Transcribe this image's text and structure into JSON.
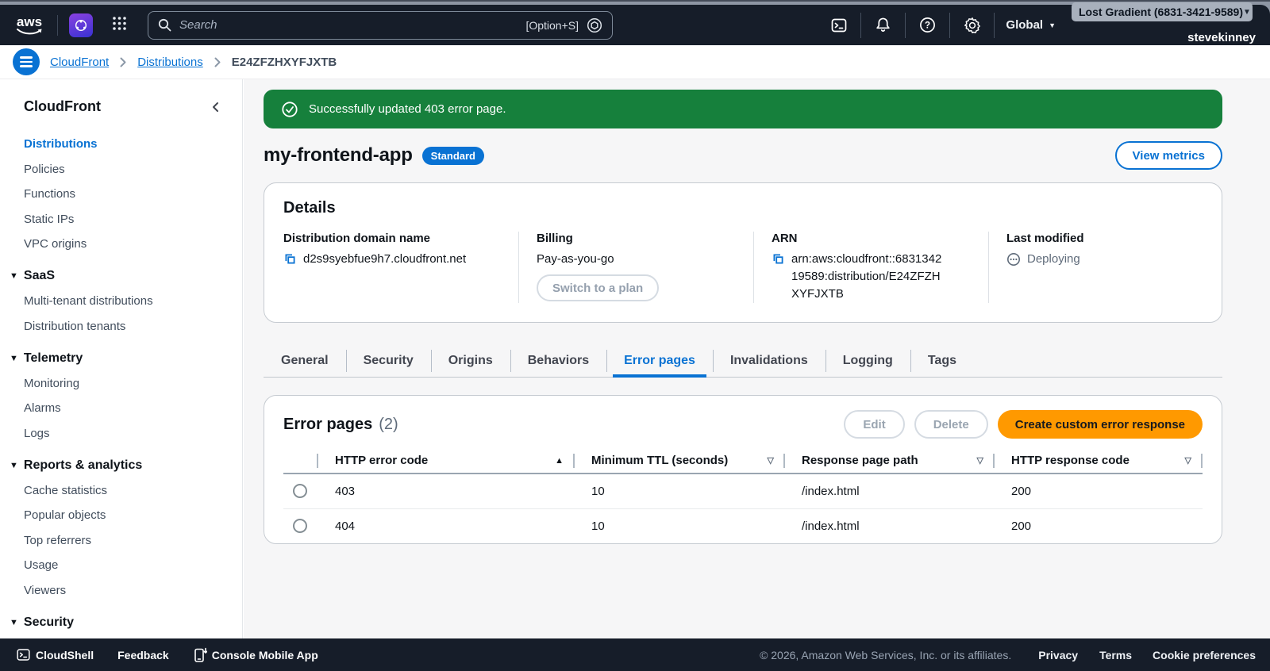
{
  "colors": {
    "accent_blue": "#0972d3",
    "success_green": "#16803c",
    "primary_orange": "#ff9900",
    "header_dark": "#161d29"
  },
  "topbar": {
    "search": {
      "placeholder": "Search",
      "shortcut": "[Option+S]"
    },
    "region": "Global",
    "account_selector": "Lost Gradient (6831-3421-9589)",
    "username": "stevekinney"
  },
  "breadcrumb": {
    "items": [
      "CloudFront",
      "Distributions",
      "E24ZFZHXYFJXTB"
    ]
  },
  "sidebar": {
    "title": "CloudFront",
    "top_items": [
      "Distributions",
      "Policies",
      "Functions",
      "Static IPs",
      "VPC origins"
    ],
    "sections": [
      {
        "title": "SaaS",
        "items": [
          "Multi-tenant distributions",
          "Distribution tenants"
        ]
      },
      {
        "title": "Telemetry",
        "items": [
          "Monitoring",
          "Alarms",
          "Logs"
        ]
      },
      {
        "title": "Reports & analytics",
        "items": [
          "Cache statistics",
          "Popular objects",
          "Top referrers",
          "Usage",
          "Viewers"
        ]
      },
      {
        "title": "Security",
        "items": []
      }
    ]
  },
  "flashbar": {
    "message": "Successfully updated 403 error page."
  },
  "page": {
    "title": "my-frontend-app",
    "badge": "Standard",
    "view_metrics_label": "View metrics"
  },
  "details": {
    "heading": "Details",
    "fields": [
      {
        "label": "Distribution domain name",
        "value": "d2s9syebfue9h7.cloudfront.net"
      },
      {
        "label": "Billing",
        "value": "Pay-as-you-go",
        "button": "Switch to a plan"
      },
      {
        "label": "ARN",
        "value": "arn:aws:cloudfront::683134219589:distribution/E24ZFZHXYFJXTB"
      },
      {
        "label": "Last modified",
        "value": "Deploying"
      }
    ]
  },
  "tabs": {
    "items": [
      "General",
      "Security",
      "Origins",
      "Behaviors",
      "Error pages",
      "Invalidations",
      "Logging",
      "Tags"
    ],
    "active": "Error pages"
  },
  "error_pages": {
    "heading": "Error pages",
    "count": "(2)",
    "buttons": {
      "edit": "Edit",
      "delete": "Delete",
      "create": "Create custom error response"
    },
    "table": {
      "columns": [
        "HTTP error code",
        "Minimum TTL (seconds)",
        "Response page path",
        "HTTP response code"
      ],
      "sort": {
        "column": "HTTP error code",
        "direction": "ascending"
      },
      "rows": [
        {
          "http_error_code": "403",
          "minimum_ttl": "10",
          "response_page_path": "/index.html",
          "http_response_code": "200"
        },
        {
          "http_error_code": "404",
          "minimum_ttl": "10",
          "response_page_path": "/index.html",
          "http_response_code": "200"
        }
      ]
    }
  },
  "footer": {
    "cloudshell": "CloudShell",
    "feedback": "Feedback",
    "mobile_app": "Console Mobile App",
    "copyright": "© 2026, Amazon Web Services, Inc. or its affiliates.",
    "links": [
      "Privacy",
      "Terms",
      "Cookie preferences"
    ]
  }
}
